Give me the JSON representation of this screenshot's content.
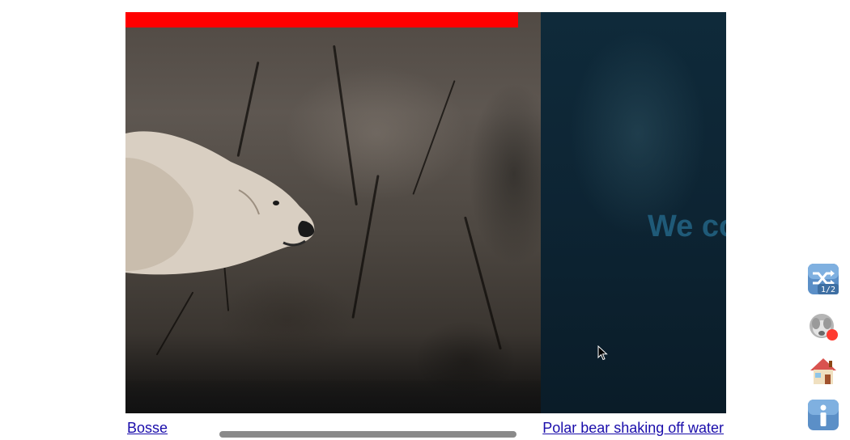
{
  "viewer": {
    "progress_fraction": 0.654,
    "progress_color": "#ff0000",
    "slide2_text": "We co"
  },
  "captions": {
    "left_link": "Bosse",
    "right_link": "Polar bear shaking off water"
  },
  "side_buttons": {
    "shuffle_badge": "1/2",
    "shuffle_icon": "shuffle-icon",
    "monkey_icon": "see-no-evil-monkey-icon",
    "home_icon": "house-icon",
    "info_icon": "info-icon",
    "record_indicator_color": "#ff3b30"
  }
}
